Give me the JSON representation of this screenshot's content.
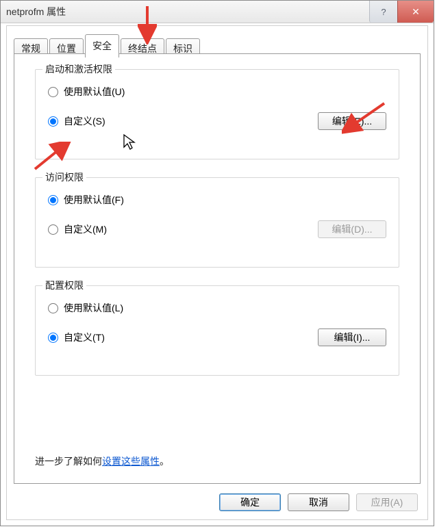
{
  "window": {
    "title": "netprofm 属性"
  },
  "tabs": [
    "常规",
    "位置",
    "安全",
    "终结点",
    "标识"
  ],
  "activeTab": "安全",
  "groups": {
    "launch": {
      "legend": "启动和激活权限",
      "default_label": "使用默认值(U)",
      "custom_label": "自定义(S)",
      "edit_label": "编辑(E)...",
      "selected": "custom",
      "edit_enabled": true
    },
    "access": {
      "legend": "访问权限",
      "default_label": "使用默认值(F)",
      "custom_label": "自定义(M)",
      "edit_label": "编辑(D)...",
      "selected": "default",
      "edit_enabled": false
    },
    "config": {
      "legend": "配置权限",
      "default_label": "使用默认值(L)",
      "custom_label": "自定义(T)",
      "edit_label": "编辑(I)...",
      "selected": "custom",
      "edit_enabled": true
    }
  },
  "help_line": {
    "prefix": "进一步了解如何",
    "link": "设置这些属性",
    "suffix": "。"
  },
  "buttons": {
    "ok": "确定",
    "cancel": "取消",
    "apply": "应用(A)"
  },
  "titlebar": {
    "help": "?",
    "close": "✕"
  },
  "colors": {
    "arrow": "#e33a2f"
  }
}
